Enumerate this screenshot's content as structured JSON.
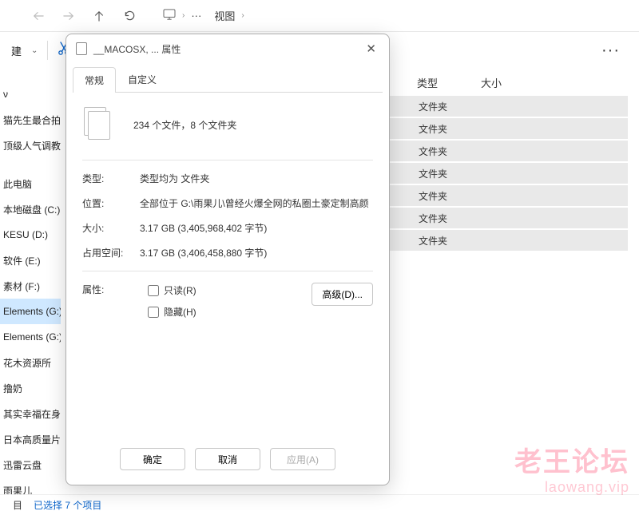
{
  "toolbar": {
    "breadcrumb_dots": "···",
    "breadcrumb_view": "视图"
  },
  "actions": {
    "new_label": "建"
  },
  "columns": {
    "type": "类型",
    "size": "大小"
  },
  "sidebar": {
    "items": [
      "ν",
      "猫先生最合拍",
      "顶级人气调教",
      "",
      "此电脑",
      "本地磁盘 (C:)",
      "KESU (D:)",
      "软件 (E:)",
      "素材 (F:)",
      "Elements (G:)",
      "Elements (G:)",
      "花木资源所",
      "撸奶",
      "其实幸福在身",
      "日本高质量片",
      "迅雷云盘",
      "雨果儿"
    ],
    "selected_index": 9
  },
  "rows": [
    {
      "type": "文件夹"
    },
    {
      "type": "文件夹"
    },
    {
      "type": "文件夹"
    },
    {
      "type": "文件夹"
    },
    {
      "type": "文件夹"
    },
    {
      "type": "文件夹"
    },
    {
      "type": "文件夹"
    }
  ],
  "status": {
    "count": "目",
    "selected": "已选择 7 个项目"
  },
  "dialog": {
    "title": "__MACOSX, ... 属性",
    "tabs": {
      "general": "常规",
      "custom": "自定义"
    },
    "summary": "234 个文件，8 个文件夹",
    "type_label": "类型:",
    "type_value": "类型均为 文件夹",
    "location_label": "位置:",
    "location_value": "全部位于 G:\\雨果儿\\曾经火爆全网的私圈土豪定制高颜",
    "size_label": "大小:",
    "size_value": "3.17 GB (3,405,968,402 字节)",
    "size_on_disk_label": "占用空间:",
    "size_on_disk_value": "3.17 GB (3,406,458,880 字节)",
    "attrs_label": "属性:",
    "readonly": "只读(R)",
    "hidden": "隐藏(H)",
    "advanced": "高级(D)...",
    "ok": "确定",
    "cancel": "取消",
    "apply": "应用(A)"
  },
  "watermark": {
    "line1": "老王论坛",
    "line2": "laowang.vip"
  }
}
